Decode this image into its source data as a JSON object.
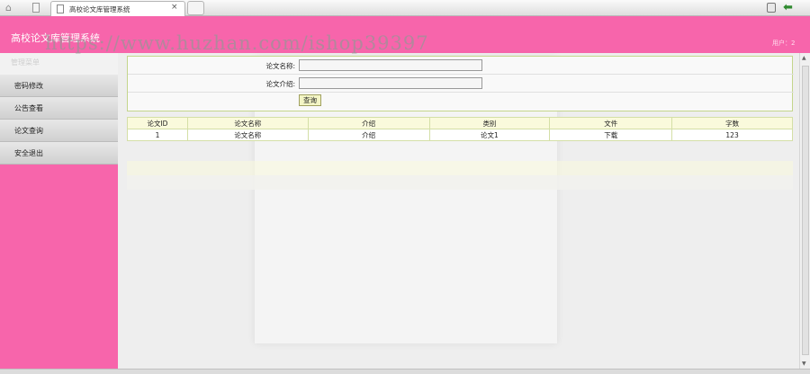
{
  "browser": {
    "tab_title": "高校论文库管理系统",
    "tab_close": "×"
  },
  "header": {
    "title": "高校论文库管理系统",
    "user_info": "用户：2"
  },
  "watermark": "https://www.huzhan.com/ishop39397",
  "sidebar": {
    "title": "管理菜单",
    "items": [
      {
        "label": "密码修改"
      },
      {
        "label": "公告查看"
      },
      {
        "label": "论文查询"
      },
      {
        "label": "安全退出"
      }
    ]
  },
  "search": {
    "name_label": "论文名称:",
    "name_value": "",
    "intro_label": "论文介绍:",
    "intro_value": "",
    "query_button": "查询"
  },
  "table": {
    "columns": [
      "论文ID",
      "论文名称",
      "介绍",
      "类别",
      "文件",
      "字数"
    ],
    "rows": [
      [
        "1",
        "论文名称",
        "介绍",
        "论文1",
        "下载",
        "123"
      ]
    ]
  }
}
